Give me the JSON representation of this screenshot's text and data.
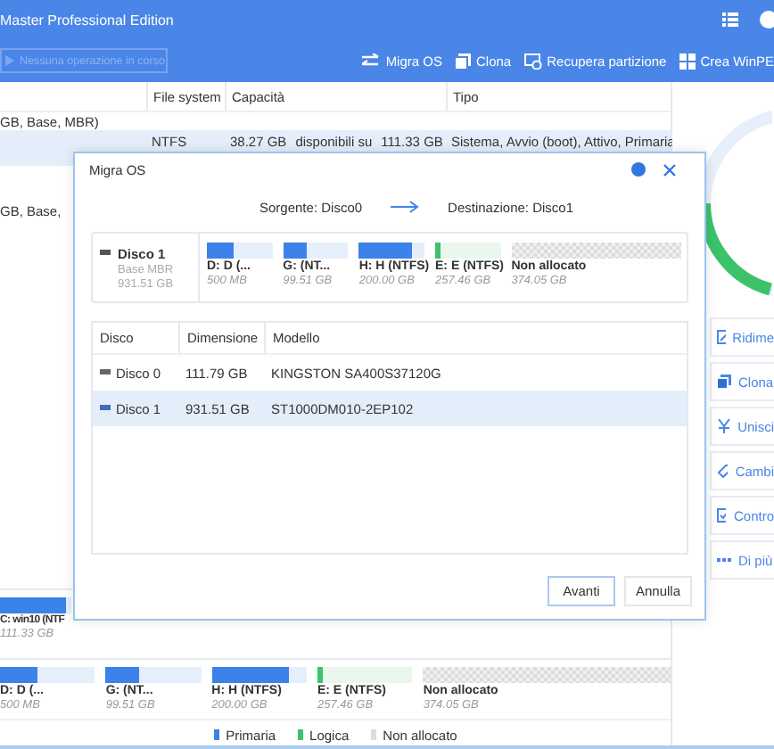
{
  "window": {
    "title": "Master Professional Edition"
  },
  "toolbar": {
    "status_field": {
      "placeholder": "Nessuna operazione in corso"
    },
    "buttons": [
      {
        "label": "Migra OS"
      },
      {
        "label": "Clona"
      },
      {
        "label": "Recupera partizione"
      },
      {
        "label": "Crea WinPE"
      }
    ]
  },
  "partition_table": {
    "columns": [
      "File system",
      "Capacità",
      "Tipo"
    ],
    "rows": [
      {
        "kind": "disk",
        "text": "GB, Base, MBR)"
      },
      {
        "kind": "partition",
        "selected": true,
        "file_system": "NTFS",
        "capacity": [
          "38.27 GB",
          "disponibili su",
          "111.33 GB"
        ],
        "type": "Sistema, Avvio (boot), Attivo, Primaria"
      },
      {
        "kind": "disk",
        "text": "GB, Base,"
      }
    ]
  },
  "side_actions": [
    {
      "label": "Ridime"
    },
    {
      "label": "Clona"
    },
    {
      "label": "Unisci"
    },
    {
      "label": "Cambi"
    },
    {
      "label": "Contro"
    },
    {
      "label": "Di più"
    }
  ],
  "disk_map": [
    {
      "partitions": [
        {
          "kind": "primary",
          "label": "C: win10 (NTF",
          "size": "111.33 GB",
          "level": 0.92
        }
      ]
    },
    {
      "partitions": [
        {
          "kind": "primary",
          "label": "D: D (...",
          "size": "500 MB",
          "level": 0.4
        },
        {
          "kind": "primary",
          "label": "G: (NT...",
          "size": "99.51 GB",
          "level": 0.35
        },
        {
          "kind": "primary",
          "label": "H: H (NTFS)",
          "size": "200.00 GB",
          "level": 0.82
        },
        {
          "kind": "logical",
          "label": "E: E (NTFS)",
          "size": "257.46 GB",
          "level": 0.05
        },
        {
          "kind": "unallocated",
          "label": "Non allocato",
          "size": "374.05 GB"
        }
      ]
    }
  ],
  "legend": [
    {
      "kind": "primary",
      "label": "Primaria"
    },
    {
      "kind": "logical",
      "label": "Logica"
    },
    {
      "kind": "unallocated",
      "label": "Non allocato"
    }
  ],
  "dialog": {
    "title": "Migra OS",
    "source": "Sorgente: Disco0",
    "destination": "Destinazione: Disco1",
    "disk": {
      "name": "Disco 1",
      "type": "Base MBR",
      "size": "931.51 GB",
      "partitions": [
        {
          "kind": "primary",
          "label": "D: D (...",
          "size": "500 MB",
          "level": 0.4
        },
        {
          "kind": "primary",
          "label": "G: (NT...",
          "size": "99.51 GB",
          "level": 0.35
        },
        {
          "kind": "primary",
          "label": "H: H (NTFS)",
          "size": "200.00 GB",
          "level": 0.82
        },
        {
          "kind": "logical",
          "label": "E: E (NTFS)",
          "size": "257.46 GB",
          "level": 0.05
        },
        {
          "kind": "unallocated",
          "label": "Non allocato",
          "size": "374.05 GB"
        }
      ]
    },
    "table": {
      "columns": [
        "Disco",
        "Dimensione",
        "Modello"
      ],
      "rows": [
        {
          "disk": "Disco 0",
          "size": "111.79 GB",
          "model": "KINGSTON SA400S37120G",
          "selected": false
        },
        {
          "disk": "Disco 1",
          "size": "931.51 GB",
          "model": "ST1000DM010-2EP102",
          "selected": true
        }
      ]
    },
    "buttons": [
      {
        "label": "Avanti",
        "kind": "primary"
      },
      {
        "label": "Annulla",
        "kind": "secondary"
      }
    ]
  }
}
